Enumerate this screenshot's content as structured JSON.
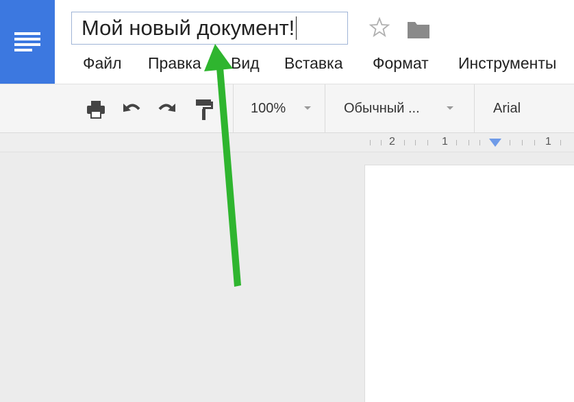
{
  "app": {
    "accent_color": "#3c78e0",
    "logo_icon": "docs-menu-icon"
  },
  "document": {
    "title": "Мой новый документ!"
  },
  "header_icons": {
    "star": "star-icon",
    "folder": "folder-icon"
  },
  "menu": [
    "Файл",
    "Правка",
    "Вид",
    "Вставка",
    "Формат",
    "Инструменты"
  ],
  "toolbar": {
    "icons": [
      "print-icon",
      "undo-icon",
      "redo-icon",
      "paint-format-icon"
    ],
    "zoom": "100%",
    "style": "Обычный ...",
    "font": "Arial"
  },
  "ruler": {
    "labels": [
      "2",
      "1",
      "1"
    ]
  },
  "annotation": {
    "arrow_color": "#2fb52f"
  }
}
